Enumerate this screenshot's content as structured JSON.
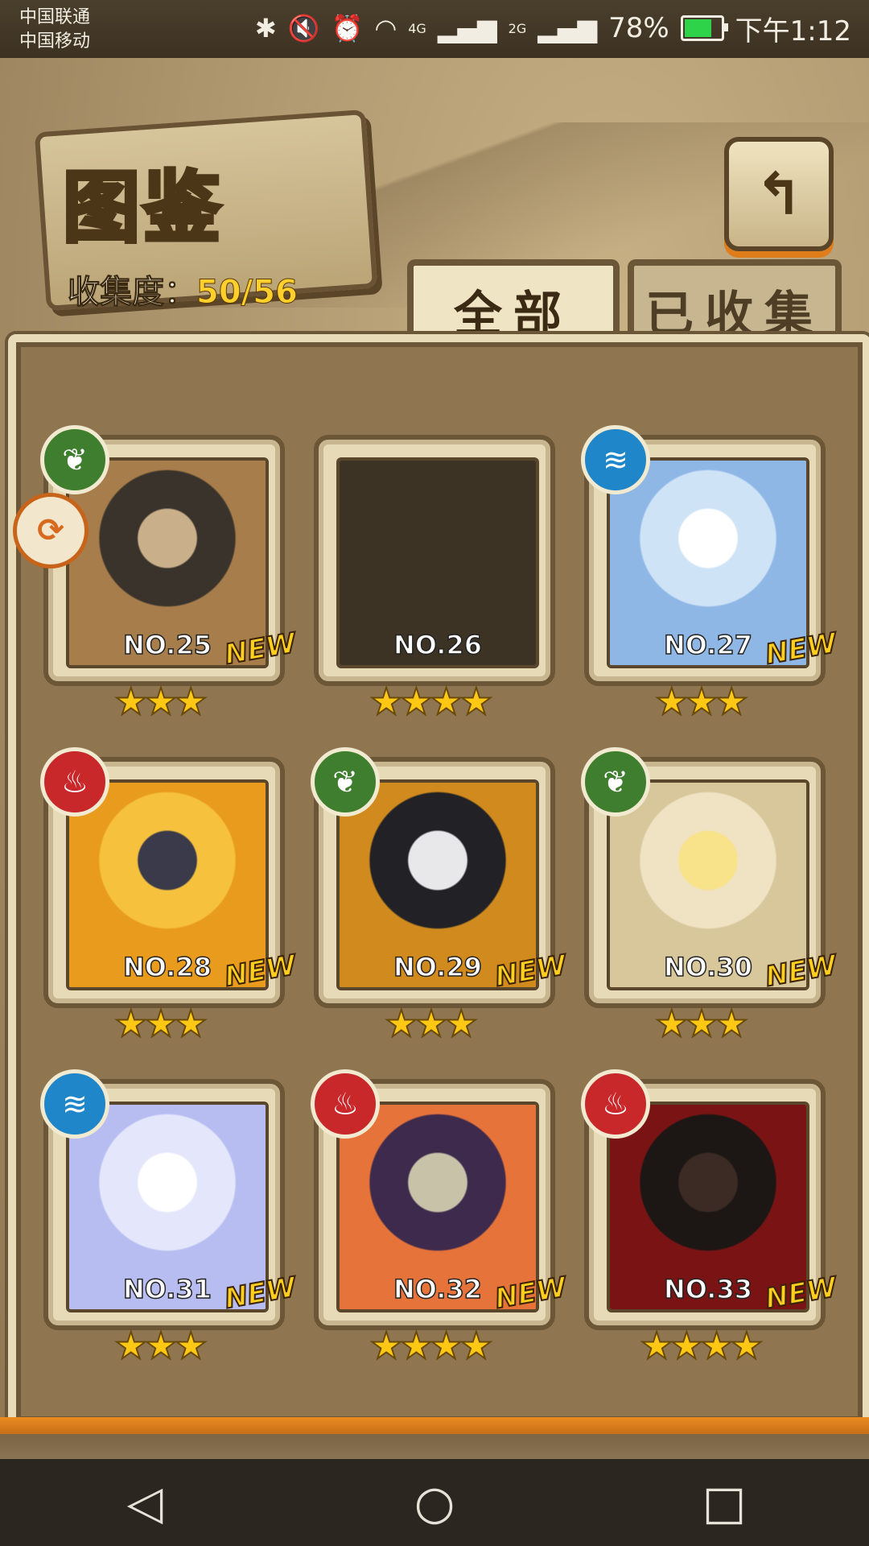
{
  "status_bar": {
    "carrier_1": "中国联通",
    "carrier_2": "中国移动",
    "signal_1_label": "4G",
    "signal_2_label": "2G",
    "battery": "78%",
    "time": "下午1:12",
    "battery_color": "#2fd34a"
  },
  "header": {
    "title": "图鉴",
    "collection_label": "收集度：",
    "collection_value": "50/56",
    "back_icon": "return-arrow-icon"
  },
  "tabs": [
    {
      "label": "全部",
      "active": true
    },
    {
      "label": "已收集",
      "active": false
    }
  ],
  "cards": [
    {
      "no": "NO.25",
      "element": "leaf",
      "stars": "★★★",
      "star_count": 3,
      "new": "NEW",
      "colors": [
        "#3a332b",
        "#a77e4b",
        "#c9b08a"
      ]
    },
    {
      "no": "NO.26",
      "element": "",
      "stars": "★★★★",
      "star_count": 4,
      "new": "",
      "colors": [
        "#3d3325",
        "#3d3325",
        "#3d3325"
      ]
    },
    {
      "no": "NO.27",
      "element": "water",
      "stars": "★★★",
      "star_count": 3,
      "new": "NEW",
      "colors": [
        "#cfe3f7",
        "#8fb7e6",
        "#ffffff"
      ]
    },
    {
      "no": "NO.28",
      "element": "fire",
      "stars": "★★★",
      "star_count": 3,
      "new": "NEW",
      "colors": [
        "#f6c13c",
        "#e99b1d",
        "#3a3a4a"
      ]
    },
    {
      "no": "NO.29",
      "element": "leaf",
      "stars": "★★★",
      "star_count": 3,
      "new": "NEW",
      "colors": [
        "#222226",
        "#d08a1d",
        "#e8e8ea"
      ]
    },
    {
      "no": "NO.30",
      "element": "leaf",
      "stars": "★★★",
      "star_count": 3,
      "new": "NEW",
      "colors": [
        "#efe3c3",
        "#d7c79a",
        "#f8e28a"
      ]
    },
    {
      "no": "NO.31",
      "element": "water",
      "stars": "★★★",
      "star_count": 3,
      "new": "NEW",
      "colors": [
        "#e4e7fb",
        "#b7bdf0",
        "#ffffff"
      ]
    },
    {
      "no": "NO.32",
      "element": "fire",
      "stars": "★★★★",
      "star_count": 4,
      "new": "NEW",
      "colors": [
        "#3d2a4c",
        "#e5733a",
        "#c8c2a9"
      ]
    },
    {
      "no": "NO.33",
      "element": "fire",
      "stars": "★★★★",
      "star_count": 4,
      "new": "NEW",
      "colors": [
        "#1c1614",
        "#7a1414",
        "#3b2b24"
      ]
    }
  ],
  "side_badge_icon": "swipe-arrow-icon",
  "navbar": {
    "back": "◁",
    "home": "○",
    "recents": "□"
  }
}
